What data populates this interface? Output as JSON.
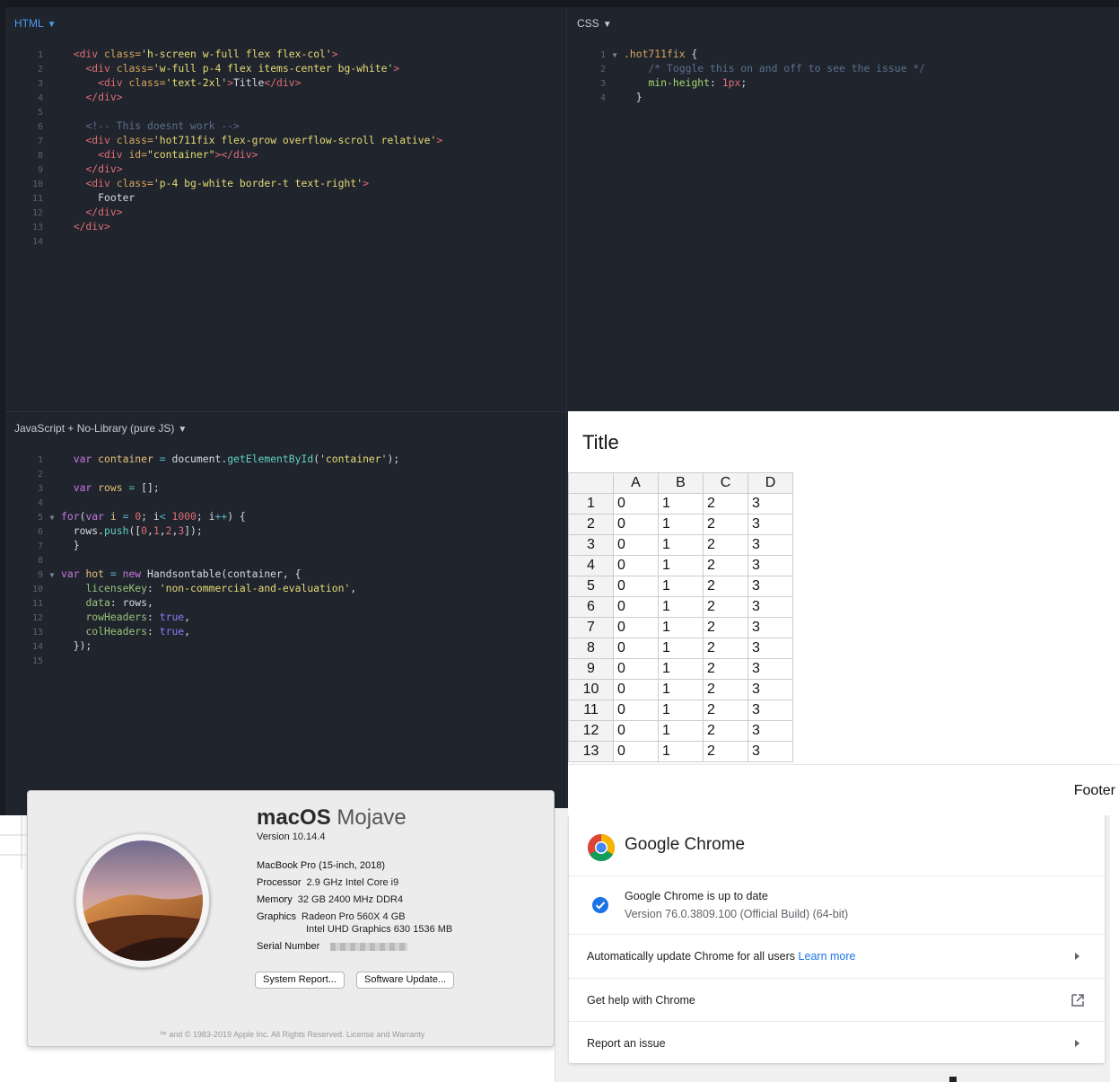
{
  "editor": {
    "html_pane": {
      "title": "HTML",
      "lines": [
        {
          "n": "1",
          "parts": [
            [
              "txt",
              "  "
            ],
            [
              "tag",
              "<div"
            ],
            [
              "attr",
              " class="
            ],
            [
              "str",
              "'h-screen w-full flex flex-col'"
            ],
            [
              "tag",
              ">"
            ]
          ]
        },
        {
          "n": "2",
          "parts": [
            [
              "txt",
              "    "
            ],
            [
              "tag",
              "<div"
            ],
            [
              "attr",
              " class="
            ],
            [
              "str",
              "'w-full p-4 flex items-center bg-white'"
            ],
            [
              "tag",
              ">"
            ]
          ]
        },
        {
          "n": "3",
          "parts": [
            [
              "txt",
              "      "
            ],
            [
              "tag",
              "<div"
            ],
            [
              "attr",
              " class="
            ],
            [
              "str",
              "'text-2xl'"
            ],
            [
              "tag",
              ">"
            ],
            [
              "txt",
              "Title"
            ],
            [
              "tag",
              "</div>"
            ]
          ]
        },
        {
          "n": "4",
          "parts": [
            [
              "txt",
              "    "
            ],
            [
              "tag",
              "</div>"
            ]
          ]
        },
        {
          "n": "5",
          "parts": [
            [
              "txt",
              ""
            ]
          ]
        },
        {
          "n": "6",
          "parts": [
            [
              "txt",
              "    "
            ],
            [
              "com",
              "<!-- This doesnt work -->"
            ]
          ]
        },
        {
          "n": "7",
          "parts": [
            [
              "txt",
              "    "
            ],
            [
              "tag",
              "<div"
            ],
            [
              "attr",
              " class="
            ],
            [
              "str",
              "'hot711fix flex-grow overflow-scroll relative'"
            ],
            [
              "tag",
              ">"
            ]
          ]
        },
        {
          "n": "8",
          "parts": [
            [
              "txt",
              "      "
            ],
            [
              "tag",
              "<div"
            ],
            [
              "attr",
              " id="
            ],
            [
              "str",
              "\"container\""
            ],
            [
              "tag",
              "></div>"
            ]
          ]
        },
        {
          "n": "9",
          "parts": [
            [
              "txt",
              "    "
            ],
            [
              "tag",
              "</div>"
            ]
          ]
        },
        {
          "n": "10",
          "parts": [
            [
              "txt",
              "    "
            ],
            [
              "tag",
              "<div"
            ],
            [
              "attr",
              " class="
            ],
            [
              "str",
              "'p-4 bg-white border-t text-right'"
            ],
            [
              "tag",
              ">"
            ]
          ]
        },
        {
          "n": "11",
          "parts": [
            [
              "txt",
              "      Footer"
            ]
          ]
        },
        {
          "n": "12",
          "parts": [
            [
              "txt",
              "    "
            ],
            [
              "tag",
              "</div>"
            ]
          ]
        },
        {
          "n": "13",
          "parts": [
            [
              "txt",
              "  "
            ],
            [
              "tag",
              "</div>"
            ]
          ]
        },
        {
          "n": "14",
          "parts": [
            [
              "txt",
              ""
            ]
          ]
        }
      ]
    },
    "css_pane": {
      "title": "CSS",
      "lines": [
        {
          "n": "1",
          "fold": true,
          "parts": [
            [
              "sel",
              ".hot711fix"
            ],
            [
              "txt",
              " {"
            ]
          ]
        },
        {
          "n": "2",
          "parts": [
            [
              "txt",
              "    "
            ],
            [
              "com",
              "/* Toggle this on and off to see the issue */"
            ]
          ]
        },
        {
          "n": "3",
          "parts": [
            [
              "txt",
              "    "
            ],
            [
              "prop",
              "min-height"
            ],
            [
              "txt",
              ": "
            ],
            [
              "num",
              "1px"
            ],
            [
              "txt",
              ";"
            ]
          ]
        },
        {
          "n": "4",
          "parts": [
            [
              "txt",
              "  }"
            ]
          ]
        }
      ]
    },
    "js_pane": {
      "title": "JavaScript + No-Library (pure JS)",
      "lines": [
        {
          "n": "1",
          "parts": [
            [
              "txt",
              "  "
            ],
            [
              "kw",
              "var"
            ],
            [
              "txt",
              " "
            ],
            [
              "var",
              "container"
            ],
            [
              "txt",
              " "
            ],
            [
              "op",
              "="
            ],
            [
              "txt",
              " document."
            ],
            [
              "fn",
              "getElementById"
            ],
            [
              "txt",
              "("
            ],
            [
              "str",
              "'container'"
            ],
            [
              "txt",
              ");"
            ]
          ]
        },
        {
          "n": "2",
          "parts": [
            [
              "txt",
              ""
            ]
          ]
        },
        {
          "n": "3",
          "parts": [
            [
              "txt",
              "  "
            ],
            [
              "kw",
              "var"
            ],
            [
              "txt",
              " "
            ],
            [
              "var",
              "rows"
            ],
            [
              "txt",
              " "
            ],
            [
              "op",
              "="
            ],
            [
              "txt",
              " [];"
            ]
          ]
        },
        {
          "n": "4",
          "parts": [
            [
              "txt",
              ""
            ]
          ]
        },
        {
          "n": "5",
          "fold": true,
          "parts": [
            [
              "kw",
              "for"
            ],
            [
              "txt",
              "("
            ],
            [
              "kw",
              "var"
            ],
            [
              "txt",
              " "
            ],
            [
              "var",
              "i"
            ],
            [
              "txt",
              " "
            ],
            [
              "op",
              "="
            ],
            [
              "txt",
              " "
            ],
            [
              "num",
              "0"
            ],
            [
              "txt",
              "; i"
            ],
            [
              "op",
              "<"
            ],
            [
              "txt",
              " "
            ],
            [
              "num",
              "1000"
            ],
            [
              "txt",
              "; i"
            ],
            [
              "op",
              "++"
            ],
            [
              "txt",
              ") {"
            ]
          ]
        },
        {
          "n": "6",
          "parts": [
            [
              "txt",
              "  rows."
            ],
            [
              "fn",
              "push"
            ],
            [
              "txt",
              "(["
            ],
            [
              "num",
              "0"
            ],
            [
              "txt",
              ","
            ],
            [
              "num",
              "1"
            ],
            [
              "txt",
              ","
            ],
            [
              "num",
              "2"
            ],
            [
              "txt",
              ","
            ],
            [
              "num",
              "3"
            ],
            [
              "txt",
              "]);"
            ]
          ]
        },
        {
          "n": "7",
          "parts": [
            [
              "txt",
              "  }"
            ]
          ]
        },
        {
          "n": "8",
          "parts": [
            [
              "txt",
              ""
            ]
          ]
        },
        {
          "n": "9",
          "fold": true,
          "parts": [
            [
              "kw",
              "var"
            ],
            [
              "txt",
              " "
            ],
            [
              "var",
              "hot"
            ],
            [
              "txt",
              " "
            ],
            [
              "op",
              "="
            ],
            [
              "txt",
              " "
            ],
            [
              "kw",
              "new"
            ],
            [
              "txt",
              " Handsontable(container, {"
            ]
          ]
        },
        {
          "n": "10",
          "parts": [
            [
              "txt",
              "    "
            ],
            [
              "green",
              "licenseKey"
            ],
            [
              "txt",
              ": "
            ],
            [
              "str",
              "'non-commercial-and-evaluation'"
            ],
            [
              "txt",
              ","
            ]
          ]
        },
        {
          "n": "11",
          "parts": [
            [
              "txt",
              "    "
            ],
            [
              "green",
              "data"
            ],
            [
              "txt",
              ": rows,"
            ]
          ]
        },
        {
          "n": "12",
          "parts": [
            [
              "txt",
              "    "
            ],
            [
              "green",
              "rowHeaders"
            ],
            [
              "txt",
              ": "
            ],
            [
              "bool",
              "true"
            ],
            [
              "txt",
              ","
            ]
          ]
        },
        {
          "n": "13",
          "parts": [
            [
              "txt",
              "    "
            ],
            [
              "green",
              "colHeaders"
            ],
            [
              "txt",
              ": "
            ],
            [
              "bool",
              "true"
            ],
            [
              "txt",
              ","
            ]
          ]
        },
        {
          "n": "14",
          "parts": [
            [
              "txt",
              "  });"
            ]
          ]
        },
        {
          "n": "15",
          "parts": [
            [
              "txt",
              ""
            ]
          ]
        }
      ]
    }
  },
  "preview": {
    "title": "Title",
    "columns": [
      "A",
      "B",
      "C",
      "D"
    ],
    "rows": [
      {
        "h": "1",
        "cells": [
          "0",
          "1",
          "2",
          "3"
        ]
      },
      {
        "h": "2",
        "cells": [
          "0",
          "1",
          "2",
          "3"
        ]
      },
      {
        "h": "3",
        "cells": [
          "0",
          "1",
          "2",
          "3"
        ]
      },
      {
        "h": "4",
        "cells": [
          "0",
          "1",
          "2",
          "3"
        ]
      },
      {
        "h": "5",
        "cells": [
          "0",
          "1",
          "2",
          "3"
        ]
      },
      {
        "h": "6",
        "cells": [
          "0",
          "1",
          "2",
          "3"
        ]
      },
      {
        "h": "7",
        "cells": [
          "0",
          "1",
          "2",
          "3"
        ]
      },
      {
        "h": "8",
        "cells": [
          "0",
          "1",
          "2",
          "3"
        ]
      },
      {
        "h": "9",
        "cells": [
          "0",
          "1",
          "2",
          "3"
        ]
      },
      {
        "h": "10",
        "cells": [
          "0",
          "1",
          "2",
          "3"
        ]
      },
      {
        "h": "11",
        "cells": [
          "0",
          "1",
          "2",
          "3"
        ]
      },
      {
        "h": "12",
        "cells": [
          "0",
          "1",
          "2",
          "3"
        ]
      },
      {
        "h": "13",
        "cells": [
          "0",
          "1",
          "2",
          "3"
        ]
      }
    ],
    "footer": "Footer"
  },
  "about_mac": {
    "os_name_bold": "macOS",
    "os_name_light": "Mojave",
    "version": "Version 10.14.4",
    "model": "MacBook Pro (15-inch, 2018)",
    "processor_label": "Processor",
    "processor": "2.9 GHz Intel Core i9",
    "memory_label": "Memory",
    "memory": "32 GB 2400 MHz DDR4",
    "graphics_label": "Graphics",
    "graphics_1": "Radeon Pro 560X 4 GB",
    "graphics_2": "Intel UHD Graphics 630 1536 MB",
    "serial_label": "Serial Number",
    "system_report_button": "System Report...",
    "software_update_button": "Software Update...",
    "copyright": "™ and © 1983-2019 Apple Inc. All Rights Reserved. License and Warranty"
  },
  "chrome_about": {
    "title": "Google Chrome",
    "status": "Google Chrome is up to date",
    "version": "Version 76.0.3809.100 (Official Build) (64-bit)",
    "auto_update_text": "Automatically update Chrome for all users",
    "learn_more": "Learn more",
    "get_help": "Get help with Chrome",
    "report_issue": "Report an issue"
  },
  "colors": {
    "editor_bg": "#1f242d",
    "chrome_blue": "#1a73e8"
  }
}
